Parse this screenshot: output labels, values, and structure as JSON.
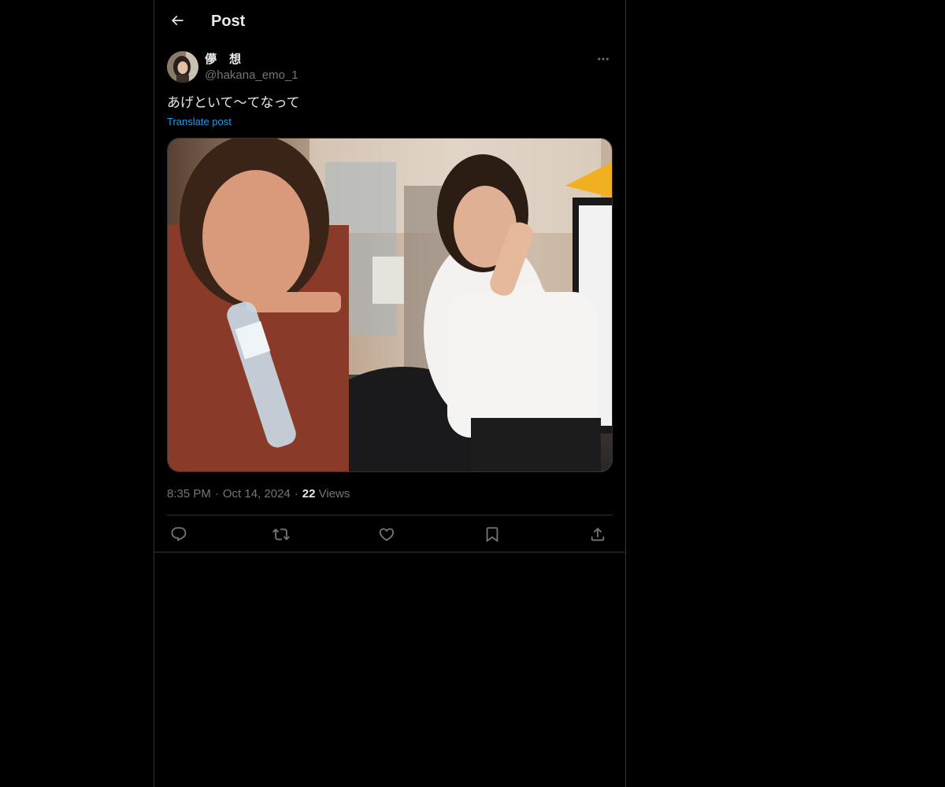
{
  "header": {
    "title": "Post",
    "back_icon": "arrow-left-icon"
  },
  "post": {
    "author": {
      "display_name": "儚 想",
      "handle": "@hakana_emo_1"
    },
    "text": "あげといて〜てなって",
    "translate_label": "Translate post",
    "media_description": "photo",
    "time": "8:35 PM",
    "date": "Oct 14, 2024",
    "separator": "·",
    "views_count": "22",
    "views_label": "Views"
  },
  "actions": {
    "reply_icon": "reply-icon",
    "repost_icon": "repost-icon",
    "like_icon": "heart-icon",
    "bookmark_icon": "bookmark-icon",
    "share_icon": "share-icon"
  },
  "colors": {
    "background": "#000000",
    "text_primary": "#e7e9ea",
    "text_secondary": "#71767b",
    "link": "#1d9bf0",
    "border": "#2f3336"
  }
}
